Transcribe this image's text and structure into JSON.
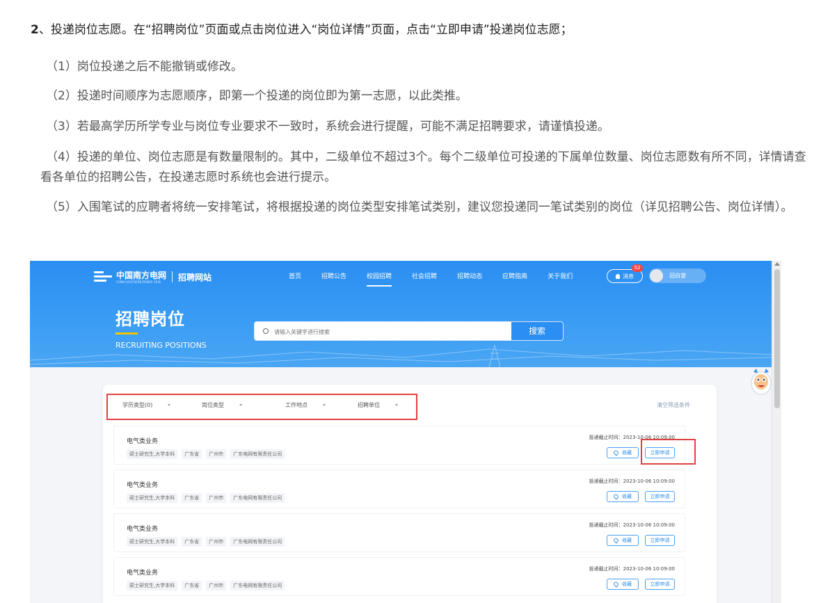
{
  "article": {
    "heading_num": "2",
    "heading_text": "、投递岗位志愿。在“招聘岗位”页面或点击岗位进入“岗位详情”页面，点击“立即申请”投递岗位志愿；",
    "items": [
      "（1）岗位投递之后不能撤销或修改。",
      "（2）投递时间顺序为志愿顺序，即第一个投递的岗位即为第一志愿，以此类推。",
      "（3）若最高学历所学专业与岗位专业要求不一致时，系统会进行提醒，可能不满足招聘要求，请谨慎投递。",
      "（4）投递的单位、岗位志愿是有数量限制的。其中，二级单位不超过3个。每个二级单位可投递的下属单位数量、岗位志愿数有所不同，详情请查看各单位的招聘公告，在投递志愿时系统也会进行提示。",
      "（5）入围笔试的应聘者将统一安排笔试，将根据投递的岗位类型安排笔试类别，建议您投递同一笔试类别的岗位（详见招聘公告、岗位详情）。"
    ]
  },
  "screenshot": {
    "logo": {
      "name": "中国南方电网",
      "sub": "CHINA SOUTHERN POWER GRID",
      "site": "招聘网站"
    },
    "nav": [
      "首页",
      "招聘公告",
      "校园招聘",
      "社会招聘",
      "招聘动态",
      "应聘指南",
      "关于我们"
    ],
    "nav_active": "校园招聘",
    "messages": {
      "label": "消息",
      "count": "52"
    },
    "user": {
      "name": "冠白楚"
    },
    "page_title": "招聘岗位",
    "page_subtitle": "RECRUITING POSITIONS",
    "search": {
      "placeholder": "请输入关键字进行搜索",
      "button": "搜索"
    },
    "filters": [
      "学历类型(0)",
      "岗位类型",
      "工作地点",
      "招聘单位"
    ],
    "clear_filters": "清空筛选条件",
    "jobs": [
      {
        "title": "电气类业务",
        "tags": [
          "硕士研究生,大学本科",
          "广东省",
          "广州市",
          "广东电网有限责任公司"
        ],
        "deadline": "投递截止时间：2023-10-06 10:09:00",
        "fav": "收藏",
        "apply": "立即申请"
      },
      {
        "title": "电气类业务",
        "tags": [
          "硕士研究生,大学本科",
          "广东省",
          "广州市",
          "广东电网有限责任公司"
        ],
        "deadline": "投递截止时间：2023-10-06 10:09:00",
        "fav": "收藏",
        "apply": "立即申请"
      },
      {
        "title": "电气类业务",
        "tags": [
          "硕士研究生,大学本科",
          "广东省",
          "广州市",
          "广东电网有限责任公司"
        ],
        "deadline": "投递截止时间：2023-10-06 10:09:00",
        "fav": "收藏",
        "apply": "立即申请"
      },
      {
        "title": "电气类业务",
        "tags": [
          "硕士研究生,大学本科",
          "广东省",
          "广州市",
          "广东电网有限责任公司"
        ],
        "deadline": "投递截止时间：2023-10-06 10:09:00",
        "fav": "收藏",
        "apply": "立即申请"
      }
    ],
    "colors": {
      "brand_blue": "#2a8ef2",
      "highlight_red": "#e04040",
      "accent_yellow": "#f5c400",
      "badge_red": "#f44646"
    }
  }
}
